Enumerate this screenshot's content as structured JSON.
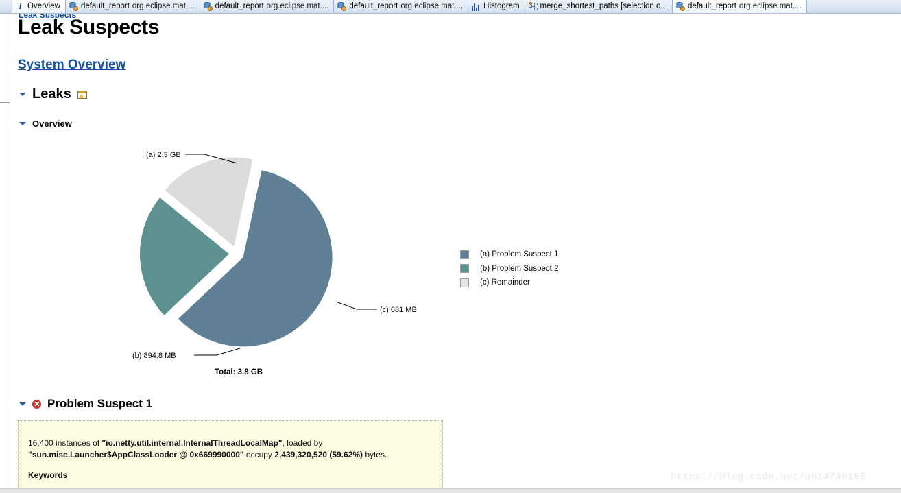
{
  "tabs": [
    {
      "id": "overview",
      "icon": "info-icon",
      "label": "Overview",
      "sub": "",
      "active": true
    },
    {
      "id": "report1",
      "icon": "report-icon",
      "label": "default_report",
      "sub": "org.eclipse.mat....",
      "active": false
    },
    {
      "id": "report2",
      "icon": "report-icon",
      "label": "default_report",
      "sub": "org.eclipse.mat....",
      "active": false
    },
    {
      "id": "report3",
      "icon": "report-icon",
      "label": "default_report",
      "sub": "org.eclipse.mat....",
      "active": false
    },
    {
      "id": "histogram",
      "icon": "histogram-icon",
      "label": "Histogram",
      "sub": "",
      "active": false
    },
    {
      "id": "merge",
      "icon": "merge-icon",
      "label": "merge_shortest_paths [selection o...",
      "sub": "",
      "active": false
    },
    {
      "id": "report4",
      "icon": "report-icon",
      "label": "default_report",
      "sub": "org.eclipse.mat....",
      "active": true
    }
  ],
  "breadcrumb": "Leak Suspects",
  "page_title": "Leak Suspects",
  "system_overview_link": "System Overview",
  "sections": {
    "leaks": {
      "label": "Leaks",
      "icon": "window-report-icon"
    },
    "overview": {
      "label": "Overview"
    },
    "problem_suspect_1": {
      "label": "Problem Suspect 1",
      "icon": "error-icon"
    }
  },
  "chart_data": {
    "type": "pie",
    "title": "",
    "total_label": "Total: 3.8 GB",
    "total_bytes": 4091000000,
    "categories": [
      "(a) Problem Suspect 1",
      "(b) Problem Suspect 2",
      "(c) Remainder"
    ],
    "values": [
      2439320520,
      938276454,
      713982443
    ],
    "labels": [
      "(a)  2.3 GB",
      "(b)  894.8 MB",
      "(c)  681 MB"
    ],
    "percentages": [
      59.62,
      22.93,
      17.45
    ],
    "colors": [
      "#5f7f94",
      "#5c918f",
      "#dcdcdc"
    ],
    "legend": [
      {
        "swatch": "#5f7f94",
        "text": "(a)  Problem Suspect 1"
      },
      {
        "swatch": "#5c918f",
        "text": "(b)  Problem Suspect 2"
      },
      {
        "swatch": "#dcdcdc",
        "text": "(c)  Remainder"
      }
    ],
    "legend_position": "right",
    "exploded": true,
    "grid": false
  },
  "suspect_box": {
    "text_1": "16,400 instances of ",
    "class_name": "\"io.netty.util.internal.InternalThreadLocalMap\"",
    "text_2": ", loaded by ",
    "loader_name": "\"sun.misc.Launcher$AppClassLoader @ 0x669990000\"",
    "text_3": " occupy ",
    "bytes": "2,439,320,520 (59.62%)",
    "text_4": " bytes.",
    "keywords_heading": "Keywords"
  },
  "watermark": "https://blog.csdn.net/u014730165"
}
